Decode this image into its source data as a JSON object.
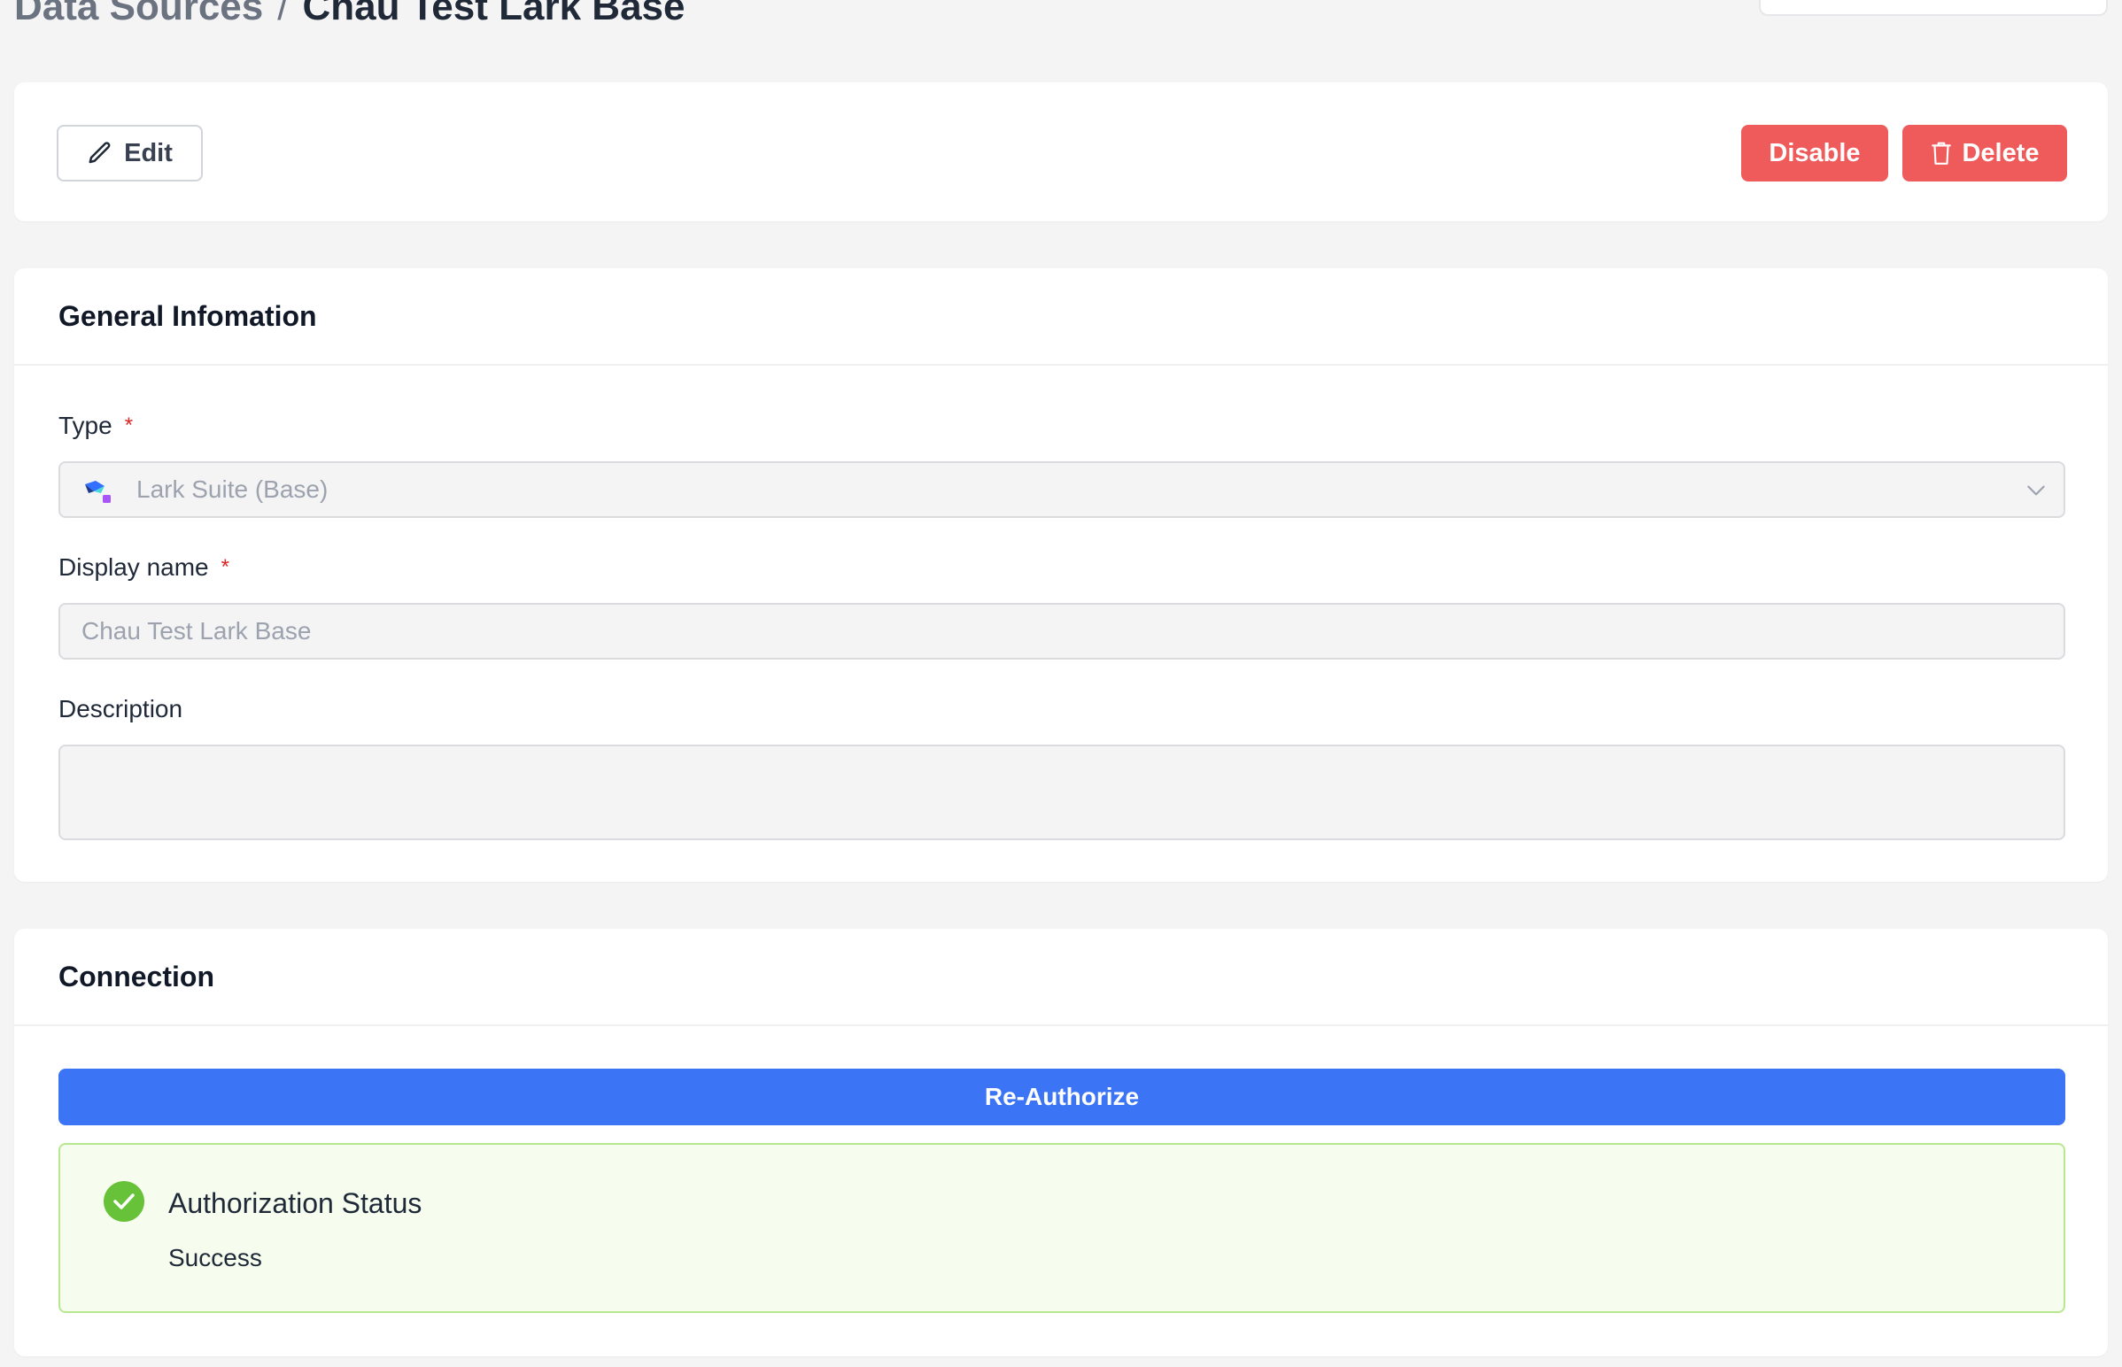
{
  "breadcrumb": {
    "parent": "Data Sources",
    "separator": "/",
    "current": "Chau Test Lark Base"
  },
  "actions": {
    "edit_label": "Edit",
    "disable_label": "Disable",
    "delete_label": "Delete"
  },
  "general": {
    "title": "General Infomation",
    "type_label": "Type",
    "type_value": "Lark Suite (Base)",
    "display_name_label": "Display name",
    "display_name_value": "Chau Test Lark Base",
    "description_label": "Description",
    "description_value": "",
    "required_mark": "*"
  },
  "connection": {
    "title": "Connection",
    "reauthorize_label": "Re-Authorize",
    "status_title": "Authorization Status",
    "status_value": "Success"
  },
  "icons": {
    "edit": "pencil-icon",
    "delete": "trash-icon",
    "type_logo": "lark-base-logo-icon",
    "dropdown": "chevron-down-icon",
    "status": "check-circle-icon"
  },
  "colors": {
    "danger": "#ef5b5b",
    "primary": "#3b74f5",
    "success": "#67c23a",
    "success_bg": "#f6fdee",
    "success_border": "#b7e88f"
  }
}
